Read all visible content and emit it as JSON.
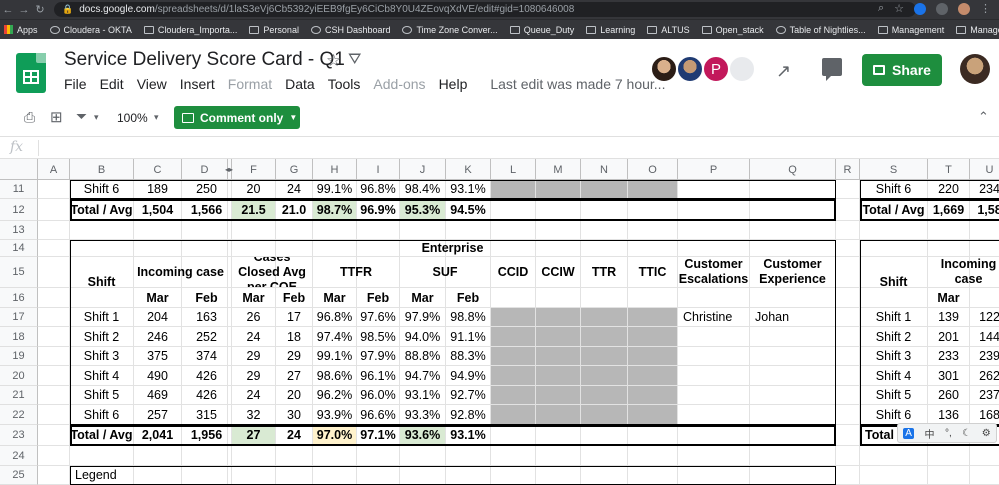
{
  "browser": {
    "url_host": "docs.google.com",
    "url_path": "/spreadsheets/d/1laS3eVj6Cb5392yiEEB9fgEy6CiCb8Y0U4ZEovqXdVE/edit#gid=1080646008",
    "bookmarks": [
      "Apps",
      "Cloudera - OKTA",
      "Cloudera_Importa...",
      "Personal",
      "CSH Dashboard",
      "Time Zone Conver...",
      "Queue_Duty",
      "Learning",
      "ALTUS",
      "Open_stack",
      "Table of Nightlies...",
      "Management",
      "Management_Help"
    ]
  },
  "doc": {
    "title": "Service Delivery Score Card - Q1",
    "menus": [
      "File",
      "Edit",
      "View",
      "Insert",
      "Format",
      "Data",
      "Tools",
      "Add-ons",
      "Help"
    ],
    "disabled_menus": [
      "Format",
      "Add-ons"
    ],
    "last_edit": "Last edit was made 7 hour...",
    "share_label": "Share",
    "avatar_letter": "P"
  },
  "toolbar": {
    "zoom": "100%",
    "mode_label": "Comment only"
  },
  "formula_bar": {
    "fx": "fx"
  },
  "columns": [
    "A",
    "B",
    "C",
    "D",
    "",
    "F",
    "G",
    "H",
    "I",
    "J",
    "K",
    "L",
    "M",
    "N",
    "O",
    "P",
    "Q",
    "R",
    "S",
    "T",
    "U"
  ],
  "rows": [
    "11",
    "12",
    "13",
    "14",
    "15",
    "16",
    "17",
    "18",
    "19",
    "20",
    "21",
    "22",
    "23",
    "24",
    "25"
  ],
  "top_table": {
    "shift6": [
      "Shift 6",
      "189",
      "250",
      "20",
      "24",
      "99.1%",
      "96.8%",
      "98.4%",
      "93.1%"
    ],
    "total": [
      "Total / Avg",
      "1,504",
      "1,566",
      "21.5",
      "21.0",
      "98.7%",
      "96.9%",
      "95.3%",
      "94.5%"
    ]
  },
  "enterprise": {
    "title": "Enterprise",
    "headers": [
      "Shift",
      "Incoming case",
      "Cases Closed Avg per COE",
      "TTFR",
      "SUF",
      "CCID",
      "CCIW",
      "TTR",
      "TTIC",
      "Customer Escalations",
      "Customer Experience"
    ],
    "subheaders": [
      "Mar",
      "Feb",
      "Mar",
      "Feb",
      "Mar",
      "Feb",
      "Mar",
      "Feb"
    ],
    "rows": [
      [
        "Shift 1",
        "204",
        "163",
        "26",
        "17",
        "96.8%",
        "97.6%",
        "97.9%",
        "98.8%"
      ],
      [
        "Shift 2",
        "246",
        "252",
        "24",
        "18",
        "97.4%",
        "98.5%",
        "94.0%",
        "91.1%"
      ],
      [
        "Shift 3",
        "375",
        "374",
        "29",
        "29",
        "99.1%",
        "97.9%",
        "88.8%",
        "88.3%"
      ],
      [
        "Shift 4",
        "490",
        "426",
        "29",
        "27",
        "98.6%",
        "96.1%",
        "94.7%",
        "94.9%"
      ],
      [
        "Shift 5",
        "469",
        "426",
        "24",
        "20",
        "96.2%",
        "96.0%",
        "93.1%",
        "92.7%"
      ],
      [
        "Shift 6",
        "257",
        "315",
        "32",
        "30",
        "93.9%",
        "96.6%",
        "93.3%",
        "92.8%"
      ]
    ],
    "escalation_shift1": "Christine",
    "experience_shift1": "Johan",
    "total": [
      "Total / Avg",
      "2,041",
      "1,956",
      "27",
      "24",
      "97.0%",
      "97.1%",
      "93.6%",
      "93.1%"
    ]
  },
  "legend": {
    "label": "Legend"
  },
  "right_table": {
    "top_shift6": [
      "Shift 6",
      "220",
      "234"
    ],
    "top_total": [
      "Total / Avg",
      "1,669",
      "1,58"
    ],
    "headers": [
      "Shift",
      "Incoming case"
    ],
    "subheader": "Mar",
    "rows": [
      [
        "Shift 1",
        "139",
        "122"
      ],
      [
        "Shift 2",
        "201",
        "144"
      ],
      [
        "Shift 3",
        "233",
        "239"
      ],
      [
        "Shift 4",
        "301",
        "262"
      ],
      [
        "Shift 5",
        "260",
        "237"
      ],
      [
        "Shift 6",
        "136",
        "168"
      ]
    ],
    "total_label": "Total /"
  },
  "ime": [
    "中",
    "°,",
    "☾",
    "⚙"
  ],
  "ime_badge": "A"
}
